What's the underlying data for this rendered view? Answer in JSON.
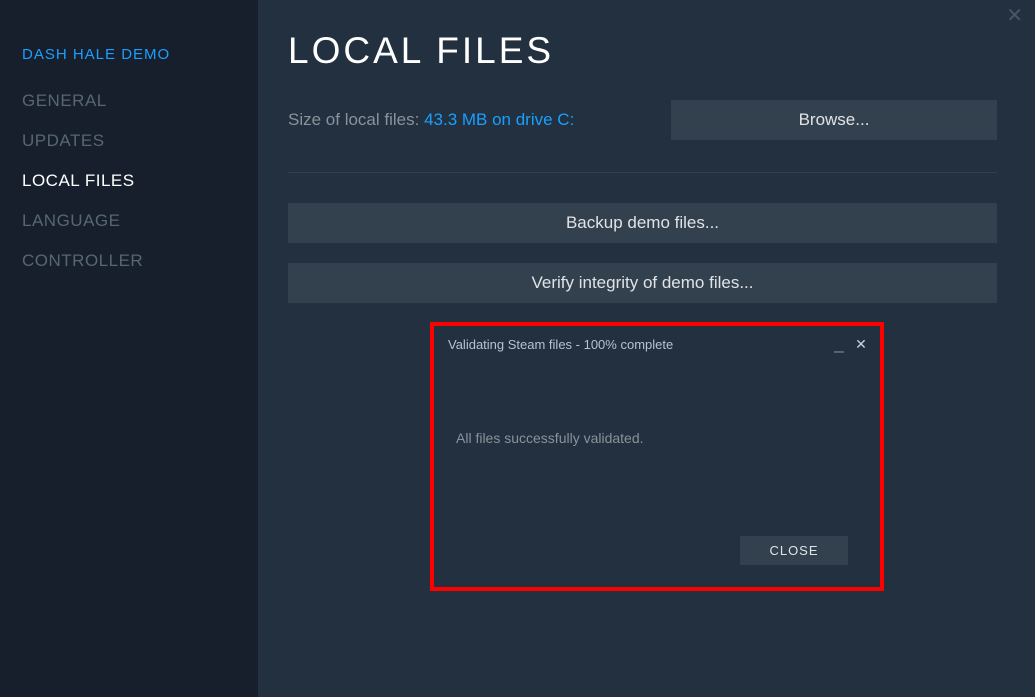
{
  "sidebar": {
    "title": "DASH HALE DEMO",
    "items": [
      {
        "label": "GENERAL"
      },
      {
        "label": "UPDATES"
      },
      {
        "label": "LOCAL FILES"
      },
      {
        "label": "LANGUAGE"
      },
      {
        "label": "CONTROLLER"
      }
    ]
  },
  "main": {
    "title": "LOCAL FILES",
    "size_label": "Size of local files: ",
    "size_value": "43.3 MB on drive C:",
    "browse_label": "Browse...",
    "backup_label": "Backup demo files...",
    "verify_label": "Verify integrity of demo files..."
  },
  "dialog": {
    "title": "Validating Steam files - 100% complete",
    "message": "All files successfully validated.",
    "close_label": "CLOSE"
  }
}
